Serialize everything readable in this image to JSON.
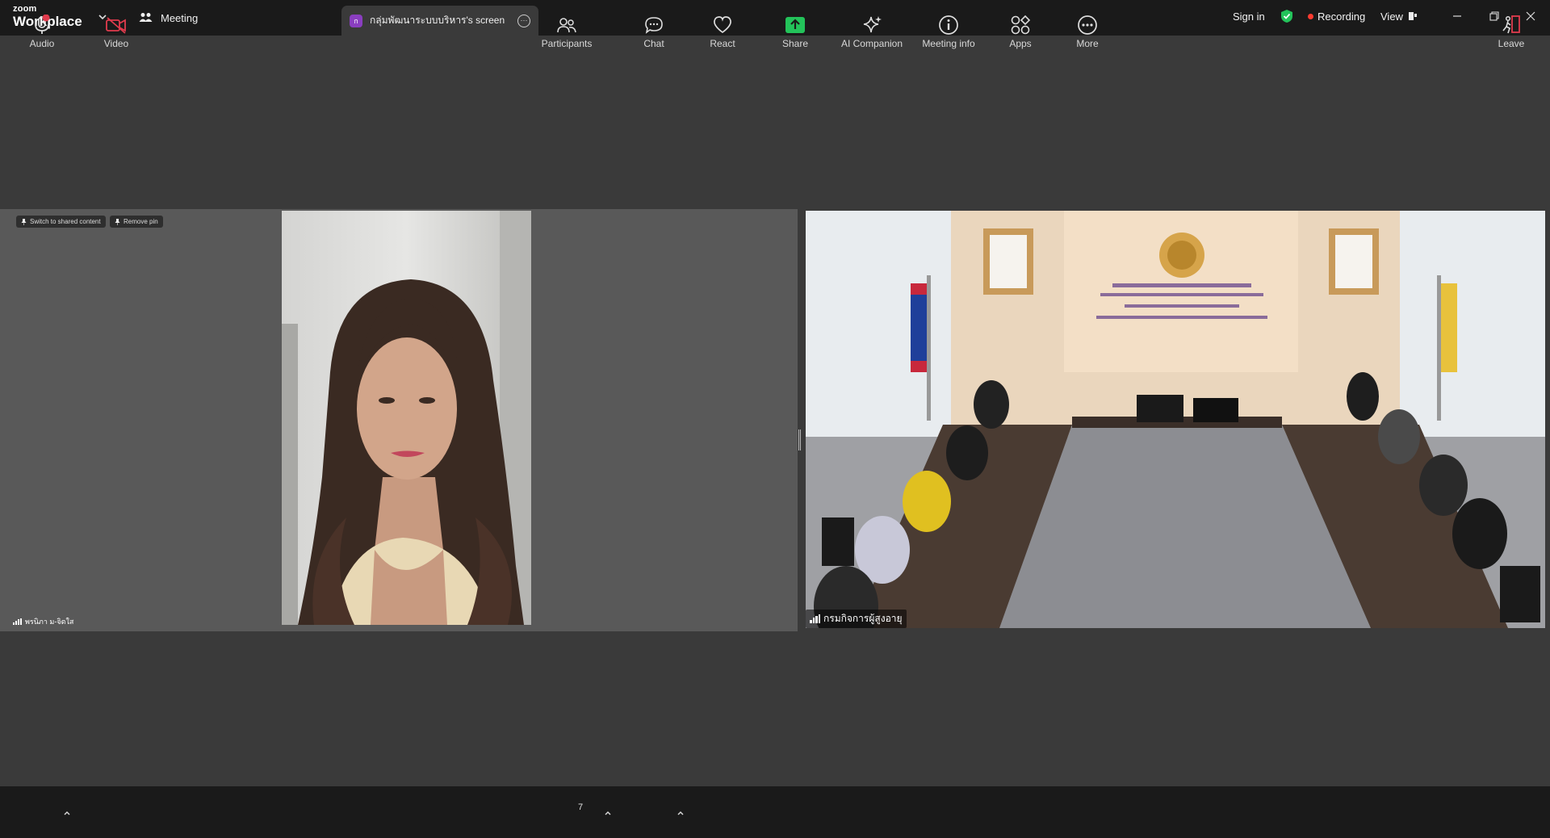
{
  "app": {
    "logo_small": "zoom",
    "logo_big": "Workplace",
    "meeting_label": "Meeting",
    "share_tab_badge": "ก",
    "share_tab_label": "กลุ่มพัฒนาระบบบริหาร's screen",
    "sign_in": "Sign in",
    "recording": "Recording",
    "view": "View",
    "accent_green": "#23c35a",
    "recording_red": "#ff3b30"
  },
  "stage": {
    "pin_buttons": [
      "Switch to shared content",
      "Remove pin"
    ],
    "left_participant_name": "พรนิภา ม-จิตใส",
    "right_participant_name": "กรมกิจการผู้สูงอายุ"
  },
  "toolbar": {
    "audio": "Audio",
    "video": "Video",
    "participants": "Participants",
    "participants_count": "7",
    "chat": "Chat",
    "react": "React",
    "share": "Share",
    "ai_companion": "AI Companion",
    "meeting_info": "Meeting info",
    "apps": "Apps",
    "more": "More",
    "leave": "Leave",
    "share_color": "#23c35a",
    "muted_red": "#e03b4d"
  }
}
